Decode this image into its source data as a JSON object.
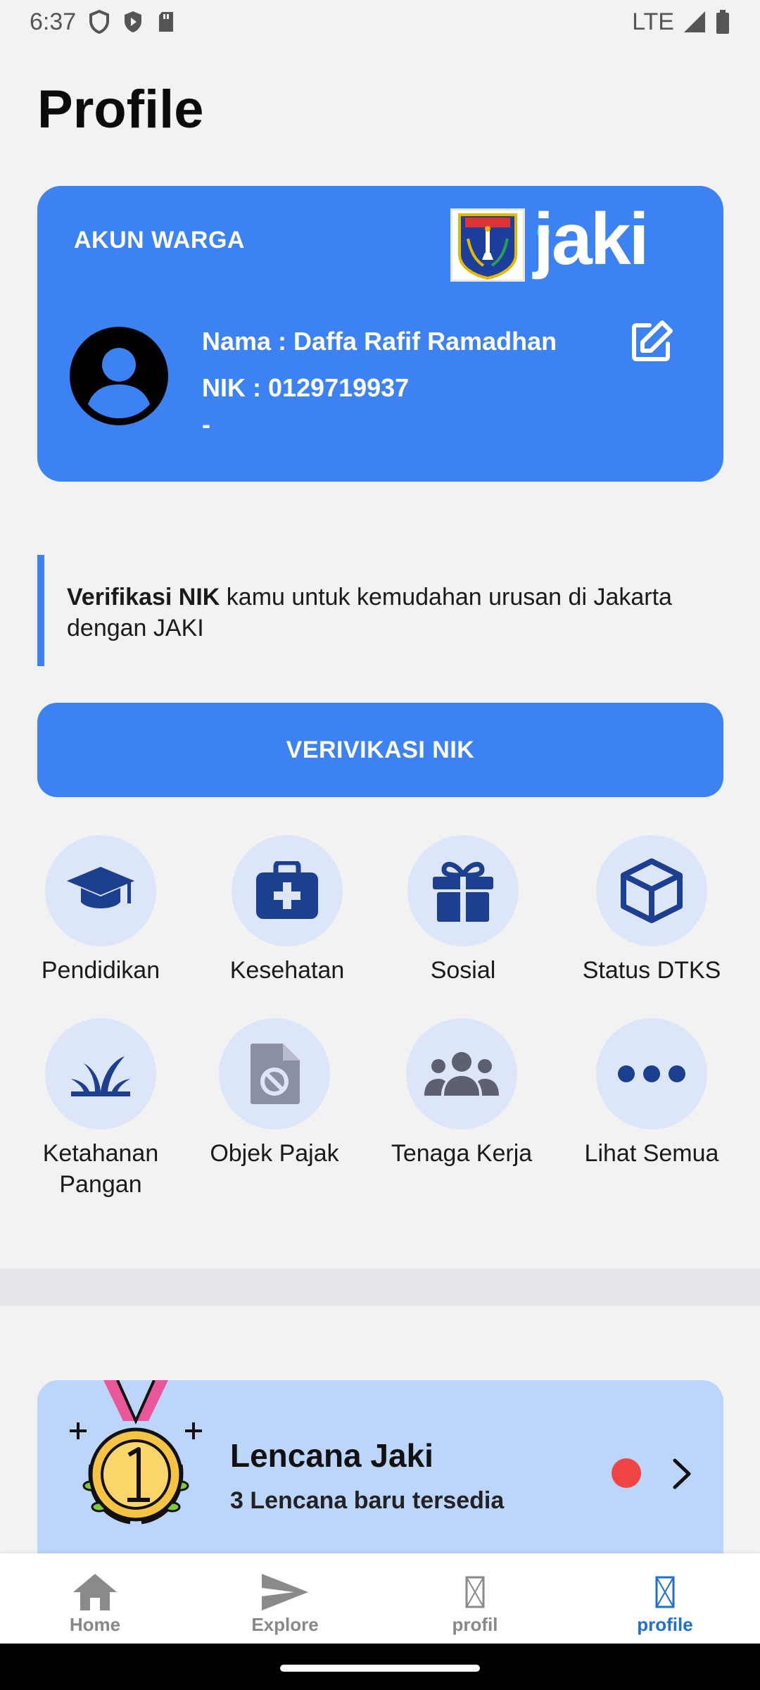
{
  "status_bar": {
    "time": "6:37",
    "network": "LTE"
  },
  "page": {
    "title": "Profile"
  },
  "account_card": {
    "label": "AKUN WARGA",
    "brand": "jaki",
    "name_line": "Nama : Daffa Rafif Ramadhan",
    "nik_line": "NIK : 0129719937",
    "extra_line": "-"
  },
  "notice": {
    "bold": "Verifikasi NIK",
    "text": " kamu untuk kemudahan urusan di Jakarta dengan JAKI"
  },
  "verify_button": {
    "label": "VERIVIKASI NIK"
  },
  "menu": [
    {
      "label": "Pendidikan",
      "icon": "graduation-cap-icon"
    },
    {
      "label": "Kesehatan",
      "icon": "medical-bag-icon"
    },
    {
      "label": "Sosial",
      "icon": "gift-icon"
    },
    {
      "label": "Status DTKS",
      "icon": "cube-icon"
    },
    {
      "label": "Ketahanan Pangan",
      "icon": "plant-icon"
    },
    {
      "label": "Objek Pajak",
      "icon": "file-block-icon"
    },
    {
      "label": "Tenaga Kerja",
      "icon": "people-icon"
    },
    {
      "label": "Lihat Semua",
      "icon": "more-dots-icon"
    }
  ],
  "badge_card": {
    "title": "Lencana Jaki",
    "subtitle": "3 Lencana baru tersedia"
  },
  "bottom_nav": [
    {
      "label": "Home",
      "icon": "home-icon",
      "active": false
    },
    {
      "label": "Explore",
      "icon": "send-icon",
      "active": false
    },
    {
      "label": "profil",
      "icon": "missing-glyph-icon",
      "active": false
    },
    {
      "label": "profile",
      "icon": "missing-glyph-icon",
      "active": true
    }
  ],
  "colors": {
    "primary": "#3d82f2",
    "icon_circle": "#dde6f9",
    "icon_dark": "#1d3f8f",
    "active_nav": "#1f6fce",
    "badge_bg": "#bcd6fb",
    "notif_dot": "#ee4444"
  }
}
